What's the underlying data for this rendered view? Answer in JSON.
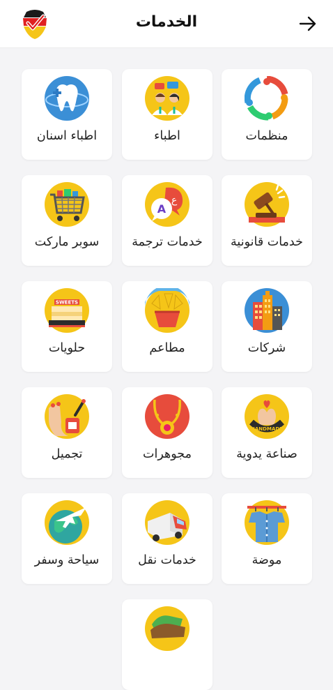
{
  "header": {
    "title": "الخدمات",
    "back_icon": "arrow-right-icon",
    "logo_icon": "brand-logo-icon"
  },
  "services": [
    {
      "label": "منظمات",
      "icon": "people-circle-icon"
    },
    {
      "label": "اطباء",
      "icon": "doctors-icon"
    },
    {
      "label": "اطباء اسنان",
      "icon": "tooth-icon"
    },
    {
      "label": "خدمات قانونية",
      "icon": "gavel-icon"
    },
    {
      "label": "خدمات ترجمة",
      "icon": "translation-icon"
    },
    {
      "label": "سوبر ماركت",
      "icon": "shopping-cart-icon"
    },
    {
      "label": "شركات",
      "icon": "buildings-icon"
    },
    {
      "label": "مطاعم",
      "icon": "food-icon"
    },
    {
      "label": "حلويات",
      "icon": "cake-icon"
    },
    {
      "label": "صناعة يدوية",
      "icon": "handmade-icon"
    },
    {
      "label": "مجوهرات",
      "icon": "necklace-icon"
    },
    {
      "label": "تجميل",
      "icon": "nail-polish-icon"
    },
    {
      "label": "موضة",
      "icon": "clothes-rack-icon"
    },
    {
      "label": "خدمات نقل",
      "icon": "truck-icon"
    },
    {
      "label": "سياحة وسفر",
      "icon": "airplane-globe-icon"
    },
    {
      "label": "",
      "icon": "money-icon"
    }
  ],
  "colors": {
    "accent": "#f5c518",
    "background": "#f4f4f6",
    "card": "#ffffff",
    "text": "#222222"
  }
}
